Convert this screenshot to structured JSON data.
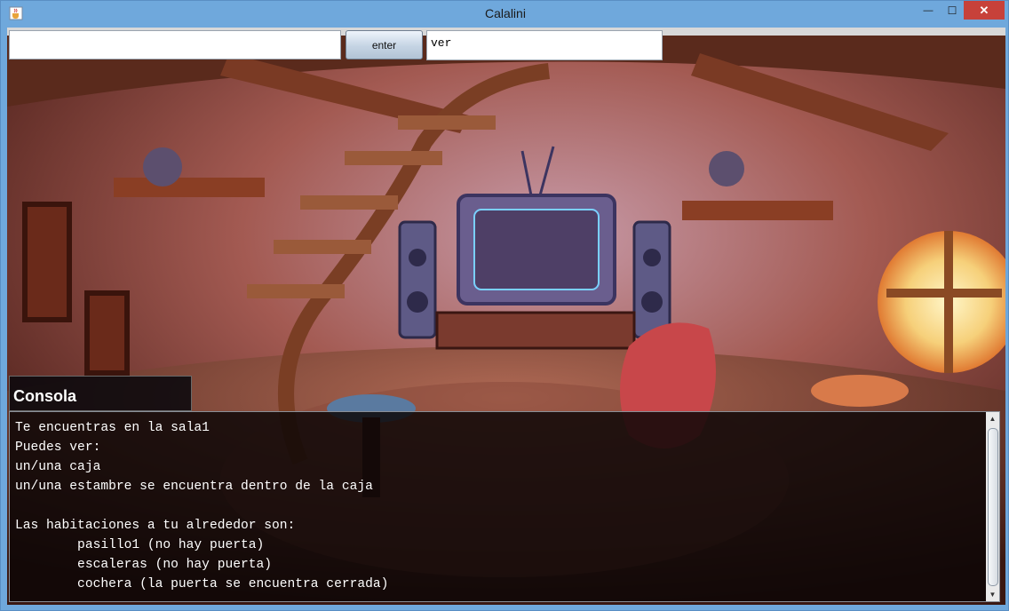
{
  "window": {
    "title": "Calalini",
    "app_icon": "java-cup-icon",
    "controls": {
      "minimize": "—",
      "maximize": "☐",
      "close": "✕"
    },
    "accent_color": "#6fa8dc",
    "close_color": "#c7413a"
  },
  "toolbar": {
    "command_value": "",
    "enter_label": "enter",
    "echo_value": "ver"
  },
  "console": {
    "label": "Consola",
    "lines": [
      "Te encuentras en la sala1",
      "Puedes ver:",
      "un/una caja",
      "un/una estambre se encuentra dentro de la caja",
      "",
      "Las habitaciones a tu alrededor son:",
      "        pasillo1 (no hay puerta)",
      "        escaleras (no hay puerta)",
      "        cochera (la puerta se encuentra cerrada)"
    ],
    "scroll_up": "▲",
    "scroll_down": "▼"
  }
}
